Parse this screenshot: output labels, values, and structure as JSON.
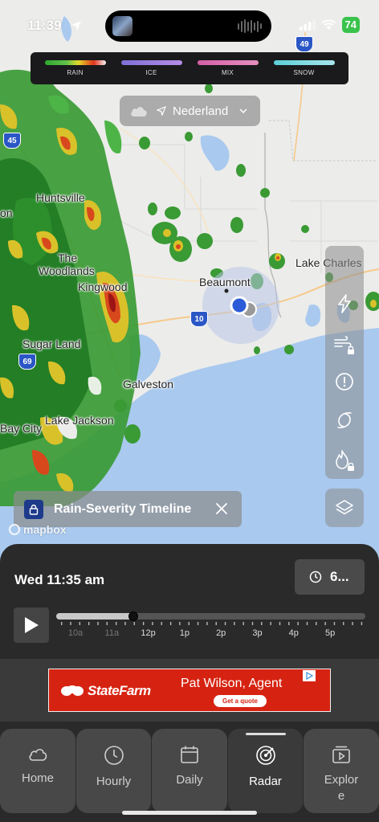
{
  "status_bar": {
    "time": "11:39",
    "battery": "74"
  },
  "legend": {
    "items": [
      {
        "label": "RAIN",
        "gradient": "linear-gradient(90deg,#2fa82f,#5fc24a 35%,#e3d92b 55%,#e0331c 80%,#f4f4f4)"
      },
      {
        "label": "ICE",
        "gradient": "linear-gradient(90deg,#7f6fd6,#b48ce6)"
      },
      {
        "label": "MIX",
        "gradient": "linear-gradient(90deg,#d45fa6,#e68fbf)"
      },
      {
        "label": "SNOW",
        "gradient": "linear-gradient(90deg,#5ad0d8,#a8e5ec)"
      }
    ]
  },
  "location": {
    "name": "Nederland"
  },
  "map": {
    "labels": {
      "huntsville": "Huntsville",
      "the": "The",
      "woodlands": "Woodlands",
      "kingwood": "Kingwood",
      "beaumont": "Beaumont",
      "lake_charles": "Lake Charles",
      "sugar_land": "Sugar Land",
      "galveston": "Galveston",
      "bay_city": "Bay City",
      "lake_jackson": "Lake Jackson",
      "on": "on"
    },
    "shields": {
      "i45": "45",
      "i69": "69",
      "i10": "10",
      "i49": "49"
    },
    "attribution": "mapbox"
  },
  "timeline_banner": {
    "text": "Rain-Severity Timeline"
  },
  "player": {
    "date_time": "Wed 11:35 am",
    "time_button": "6...",
    "progress": 0.25,
    "tick_labels": [
      "10a",
      "11a",
      "12p",
      "1p",
      "2p",
      "3p",
      "4p",
      "5p"
    ]
  },
  "ad": {
    "brand": "StateFarm",
    "agent": "Pat Wilson, Agent",
    "cta": "Get a quote"
  },
  "tabs": [
    {
      "label": "Home",
      "icon": "cloud-icon"
    },
    {
      "label": "Hourly",
      "icon": "clock-icon"
    },
    {
      "label": "Daily",
      "icon": "calendar-icon"
    },
    {
      "label": "Radar",
      "icon": "radar-icon",
      "active": true
    },
    {
      "label": "Explor e",
      "icon": "play-square-icon"
    }
  ],
  "colors": {
    "water": "#a9c9ef",
    "land": "#ececea",
    "panel": "#2a2a2a",
    "accent_blue": "#2b5bd6",
    "ad_red": "#d62311"
  }
}
